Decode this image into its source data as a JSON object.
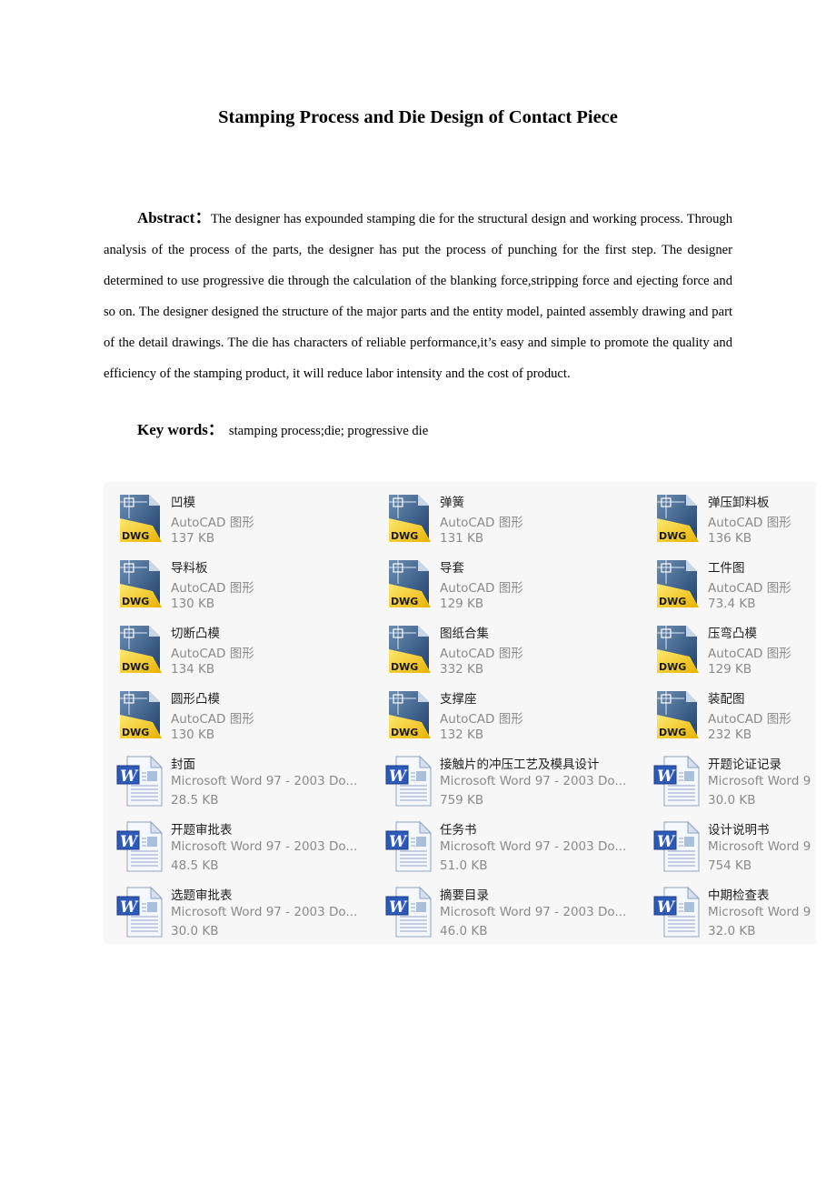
{
  "document": {
    "title": "Stamping Process and Die Design of Contact Piece",
    "abstract_label": "Abstract：",
    "abstract_text": "The designer has expounded stamping die for the structural design and working process. Through analysis of the process of the parts, the designer has put the process of punching for the first step. The designer determined to use progressive die through the calculation of the blanking force,stripping force and ejecting force and so on. The designer designed the structure of the major parts and the entity model, painted assembly drawing and part of the detail drawings. The die has characters of reliable performance,it’s easy and simple to promote the quality and efficiency of the stamping product, it will reduce labor intensity and the cost of product.",
    "keywords_label": "Key words：",
    "keywords_text": "stamping process;die; progressive die"
  },
  "file_list": {
    "columns": [
      [
        {
          "name": "凹模",
          "type": "AutoCAD 图形",
          "size": "137 KB",
          "icon": "dwg-file-icon"
        },
        {
          "name": "导料板",
          "type": "AutoCAD 图形",
          "size": "130 KB",
          "icon": "dwg-file-icon"
        },
        {
          "name": "切断凸模",
          "type": "AutoCAD 图形",
          "size": "134 KB",
          "icon": "dwg-file-icon"
        },
        {
          "name": "圆形凸模",
          "type": "AutoCAD 图形",
          "size": "130 KB",
          "icon": "dwg-file-icon"
        },
        {
          "name": "封面",
          "type": "Microsoft Word 97 - 2003 Do...",
          "size": "28.5 KB",
          "icon": "word-doc-icon"
        },
        {
          "name": "开题审批表",
          "type": "Microsoft Word 97 - 2003 Do...",
          "size": "48.5 KB",
          "icon": "word-doc-icon"
        },
        {
          "name": "选题审批表",
          "type": "Microsoft Word 97 - 2003 Do...",
          "size": "30.0 KB",
          "icon": "word-doc-icon"
        }
      ],
      [
        {
          "name": "弹簧",
          "type": "AutoCAD 图形",
          "size": "131 KB",
          "icon": "dwg-file-icon"
        },
        {
          "name": "导套",
          "type": "AutoCAD 图形",
          "size": "129 KB",
          "icon": "dwg-file-icon"
        },
        {
          "name": "图纸合集",
          "type": "AutoCAD 图形",
          "size": "332 KB",
          "icon": "dwg-file-icon"
        },
        {
          "name": "支撑座",
          "type": "AutoCAD 图形",
          "size": "132 KB",
          "icon": "dwg-file-icon"
        },
        {
          "name": "接触片的冲压工艺及模具设计",
          "type": "Microsoft Word 97 - 2003 Do...",
          "size": "759 KB",
          "icon": "word-doc-icon"
        },
        {
          "name": "任务书",
          "type": "Microsoft Word 97 - 2003 Do...",
          "size": "51.0 KB",
          "icon": "word-doc-icon"
        },
        {
          "name": "摘要目录",
          "type": "Microsoft Word 97 - 2003 Do...",
          "size": "46.0 KB",
          "icon": "word-doc-icon"
        }
      ],
      [
        {
          "name": "弹压卸料板",
          "type": "AutoCAD 图形",
          "size": "136 KB",
          "icon": "dwg-file-icon"
        },
        {
          "name": "工件图",
          "type": "AutoCAD 图形",
          "size": "73.4 KB",
          "icon": "dwg-file-icon"
        },
        {
          "name": "压弯凸模",
          "type": "AutoCAD 图形",
          "size": "129 KB",
          "icon": "dwg-file-icon"
        },
        {
          "name": "装配图",
          "type": "AutoCAD 图形",
          "size": "232 KB",
          "icon": "dwg-file-icon"
        },
        {
          "name": "开题论证记录",
          "type": "Microsoft Word 9",
          "size": "30.0 KB",
          "icon": "word-doc-icon"
        },
        {
          "name": "设计说明书",
          "type": "Microsoft Word 9",
          "size": "754 KB",
          "icon": "word-doc-icon"
        },
        {
          "name": "中期检查表",
          "type": "Microsoft Word 9",
          "size": "32.0 KB",
          "icon": "word-doc-icon"
        }
      ]
    ],
    "dwg_badge": "DWG",
    "word_badge": "W"
  }
}
